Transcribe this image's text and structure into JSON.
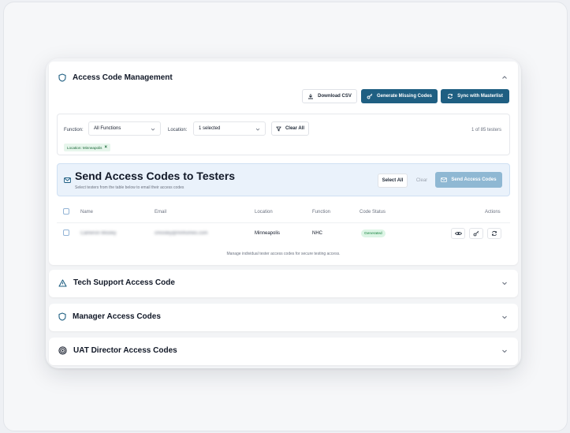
{
  "main_section": {
    "title": "Access Code Management",
    "toolbar": {
      "download_label": "Download CSV",
      "generate_label": "Generate Missing Codes",
      "sync_label": "Sync with Masterlist"
    },
    "filters": {
      "function_label": "Function:",
      "function_value": "All Functions",
      "location_label": "Location:",
      "location_value": "1 selected",
      "clear_all_label": "Clear All",
      "count_text": "1 of 85 testers",
      "active_chip": "Location: Minneapolis"
    },
    "send_panel": {
      "title": "Send Access Codes to Testers",
      "subtitle": "Select testers from the table below to email their access codes",
      "select_all_label": "Select All",
      "clear_label": "Clear",
      "send_label": "Send Access Codes"
    },
    "table": {
      "headers": {
        "name": "Name",
        "email": "Email",
        "location": "Location",
        "function": "Function",
        "code_status": "Code Status",
        "actions": "Actions"
      },
      "rows": [
        {
          "name": "Cameron Mosley",
          "email": "cmosley@mnhomes.com",
          "location": "Minneapolis",
          "function": "NHC",
          "code_status": "Generated"
        }
      ]
    },
    "footnote": "Manage individual tester access codes for secure testing access."
  },
  "collapsed_sections": [
    {
      "title": "Tech Support Access Code",
      "icon": "warning-triangle-icon"
    },
    {
      "title": "Manager Access Codes",
      "icon": "shield-icon"
    },
    {
      "title": "UAT Director Access Codes",
      "icon": "target-icon"
    }
  ],
  "colors": {
    "primary": "#1f5f82",
    "send_panel_bg": "#eaf2fb",
    "badge_bg": "#dcf5e5",
    "badge_text": "#15803d",
    "disabled_primary": "#8fb8d3"
  }
}
